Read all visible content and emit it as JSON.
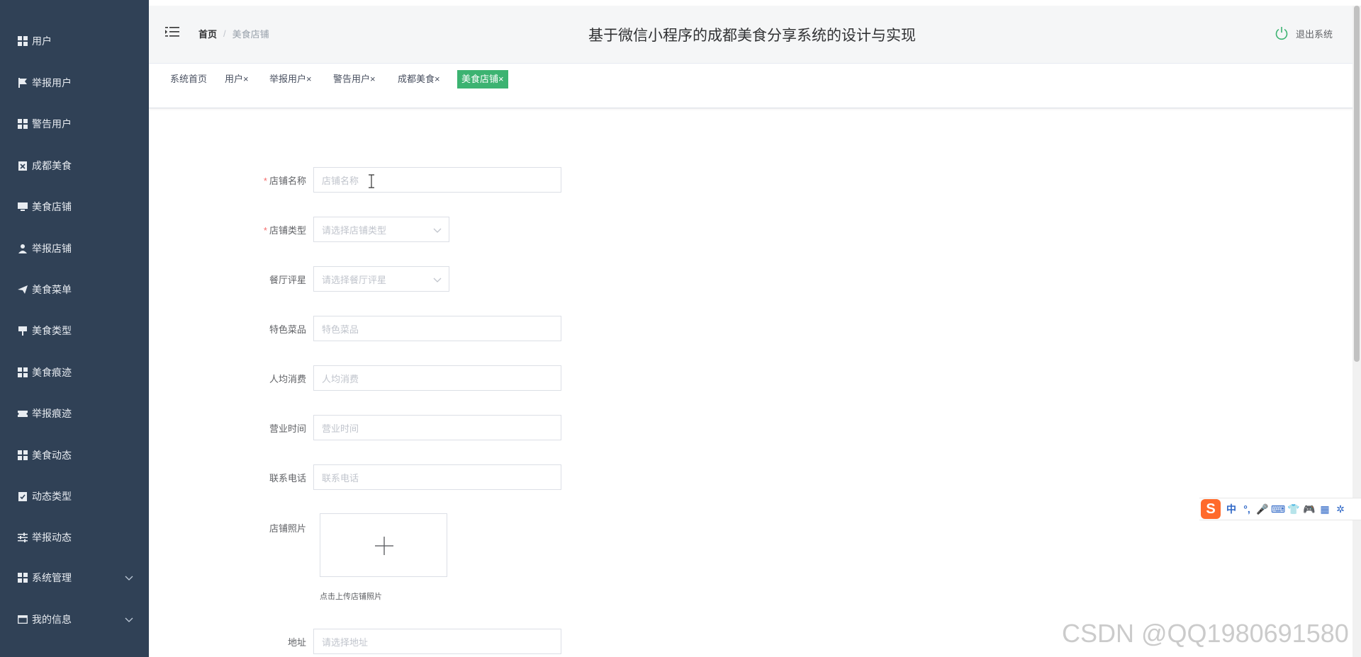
{
  "sidebar": {
    "items": [
      {
        "label": "用户",
        "icon": "grid-icon"
      },
      {
        "label": "举报用户",
        "icon": "flag-icon"
      },
      {
        "label": "警告用户",
        "icon": "grid-icon"
      },
      {
        "label": "成都美食",
        "icon": "clipboard-icon"
      },
      {
        "label": "美食店铺",
        "icon": "monitor-icon"
      },
      {
        "label": "举报店铺",
        "icon": "user-icon"
      },
      {
        "label": "美食菜单",
        "icon": "paper-plane-icon"
      },
      {
        "label": "美食类型",
        "icon": "sign-icon"
      },
      {
        "label": "美食痕迹",
        "icon": "grid-icon"
      },
      {
        "label": "举报痕迹",
        "icon": "ticket-icon"
      },
      {
        "label": "美食动态",
        "icon": "grid-icon"
      },
      {
        "label": "动态类型",
        "icon": "check-clipboard-icon"
      },
      {
        "label": "举报动态",
        "icon": "sliders-icon"
      },
      {
        "label": "系统管理",
        "icon": "grid-icon",
        "expandable": true
      },
      {
        "label": "我的信息",
        "icon": "window-icon",
        "expandable": true
      }
    ]
  },
  "header": {
    "breadcrumb_home": "首页",
    "breadcrumb_sep": "/",
    "breadcrumb_current": "美食店铺",
    "title": "基于微信小程序的成都美食分享系统的设计与实现",
    "logout_label": "退出系统"
  },
  "tabs": [
    {
      "label": "系统首页",
      "active": false
    },
    {
      "label": "用户×",
      "active": false
    },
    {
      "label": "举报用户×",
      "active": false
    },
    {
      "label": "警告用户×",
      "active": false
    },
    {
      "label": "成都美食×",
      "active": false
    },
    {
      "label": "美食店铺×",
      "active": true
    }
  ],
  "form": {
    "shop_name": {
      "label": "店铺名称",
      "required": true,
      "placeholder": "店铺名称"
    },
    "shop_type": {
      "label": "店铺类型",
      "required": true,
      "placeholder": "请选择店铺类型"
    },
    "rating": {
      "label": "餐厅评星",
      "required": false,
      "placeholder": "请选择餐厅评星"
    },
    "special_dish": {
      "label": "特色菜品",
      "placeholder": "特色菜品"
    },
    "avg_cost": {
      "label": "人均消费",
      "placeholder": "人均消费"
    },
    "hours": {
      "label": "营业时间",
      "placeholder": "营业时间"
    },
    "phone": {
      "label": "联系电话",
      "placeholder": "联系电话"
    },
    "photo": {
      "label": "店铺照片",
      "tip": "点击上传店铺照片"
    },
    "address": {
      "label": "地址",
      "placeholder": "请选择地址"
    }
  },
  "ime": {
    "logo": "S",
    "keys": [
      "中",
      "°,",
      "🎤",
      "⌨",
      "👕",
      "🎮",
      "▦",
      "✲"
    ]
  },
  "watermark": "CSDN @QQ1980691580",
  "colors": {
    "sidebar_bg": "#304156",
    "active_tab": "#3cb371",
    "required": "#f56c6c"
  }
}
